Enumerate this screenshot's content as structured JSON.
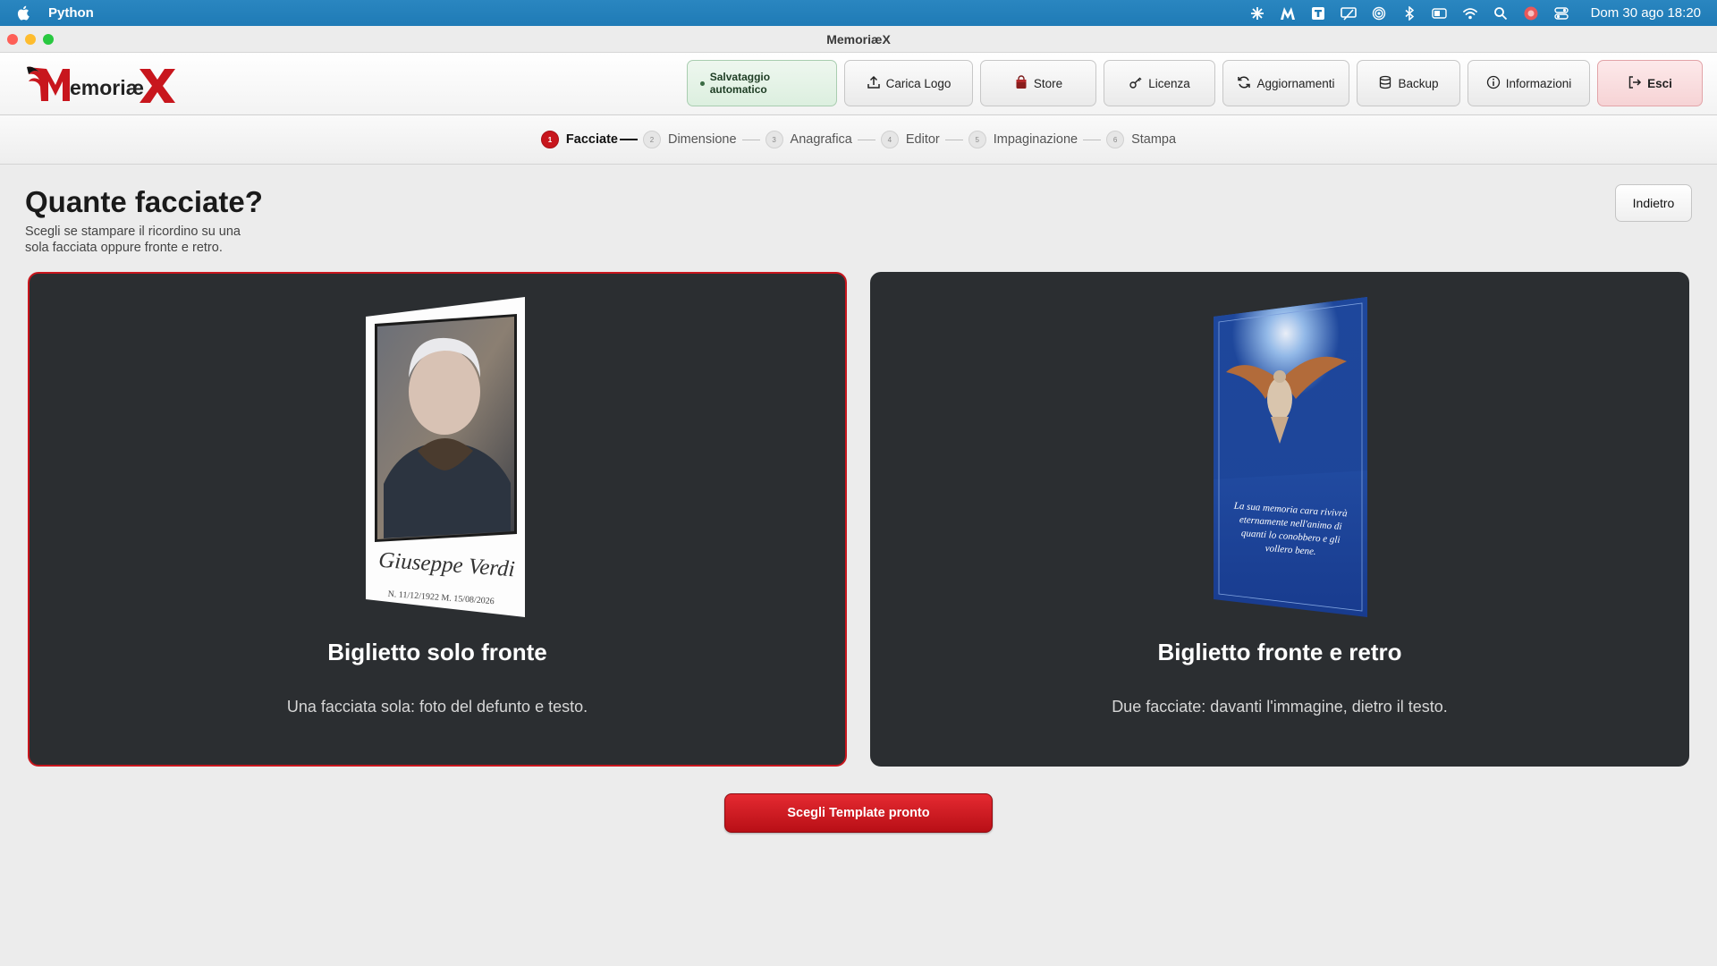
{
  "menubar": {
    "app_name": "Python",
    "clock": "Dom 30 ago  18:20",
    "status_icons": [
      "asterisk-icon",
      "m-icon",
      "t-icon",
      "screen-icon",
      "airdrop-icon",
      "bluetooth-icon",
      "battery-icon",
      "wifi-icon",
      "search-icon",
      "avatar-icon",
      "control-center-icon"
    ]
  },
  "window": {
    "title": "MemoriæX",
    "traffic_colors": [
      "#fe5f57",
      "#febc2e",
      "#28c840"
    ]
  },
  "header": {
    "logo_text": "MemoriæX",
    "buttons": {
      "autosave": "Salvataggio automatico",
      "upload_logo": "Carica Logo",
      "store": "Store",
      "license": "Licenza",
      "updates": "Aggiornamenti",
      "backup": "Backup",
      "info": "Informazioni",
      "exit": "Esci"
    }
  },
  "stepper": {
    "steps": [
      {
        "num": "1",
        "label": "Facciate",
        "active": true
      },
      {
        "num": "2",
        "label": "Dimensione"
      },
      {
        "num": "3",
        "label": "Anagrafica"
      },
      {
        "num": "4",
        "label": "Editor"
      },
      {
        "num": "5",
        "label": "Impaginazione"
      },
      {
        "num": "6",
        "label": "Stampa"
      }
    ]
  },
  "page": {
    "title": "Quante facciate?",
    "subtitle": "Scegli se stampare il ricordino su una sola facciata oppure fronte e retro.",
    "back_label": "Indietro"
  },
  "options": [
    {
      "title": "Biglietto solo fronte",
      "description": "Una facciata sola: foto del defunto e testo.",
      "preview_name": "Giuseppe Verdi",
      "preview_dates": "N. 11/12/1922   M. 15/08/2026",
      "selected": true
    },
    {
      "title": "Biglietto fronte e retro",
      "description": "Due facciate: davanti l'immagine, dietro il testo.",
      "preview_verse": [
        "La sua memoria cara rivivrà",
        "eternamente nell'animo di",
        "quanti lo conobbero e gli",
        "vollero bene."
      ],
      "selected": false
    }
  ],
  "cta_label": "Scegli Template pronto",
  "colors": {
    "accent": "#c8161d",
    "card_bg": "#2b2e31",
    "menubar": "#2180ba"
  }
}
